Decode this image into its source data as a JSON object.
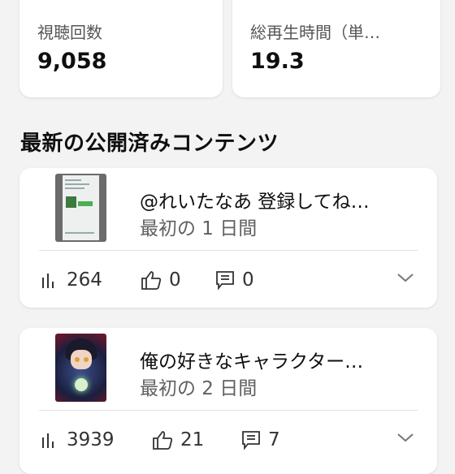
{
  "stats": {
    "views": {
      "label": "視聴回数",
      "value": "9,058"
    },
    "watch_time": {
      "label": "総再生時間（単…",
      "value": "19.3"
    }
  },
  "section_title": "最新の公開済みコンテンツ",
  "contents": [
    {
      "title": "@れいたなあ 登録してね…",
      "subtitle": "最初の 1 日間",
      "views": "264",
      "likes": "0",
      "comments": "0"
    },
    {
      "title": "俺の好きなキャラクター…",
      "subtitle": "最初の 2 日間",
      "views": "3939",
      "likes": "21",
      "comments": "7"
    }
  ],
  "icons": [
    "bar-chart-icon",
    "thumb-up-icon",
    "comment-icon",
    "chevron-down-icon"
  ]
}
